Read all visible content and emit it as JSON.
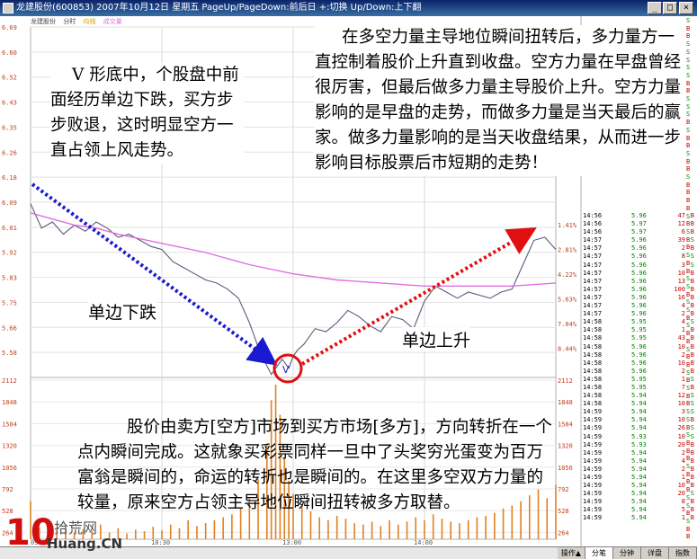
{
  "window": {
    "title": "龙建股份(600853) 2007年10月12日 星期五 PageUp/PageDown:前后日 +:切换 Up/Down:上下翻",
    "minimize_glyph": "_",
    "maximize_glyph": "□",
    "close_glyph": "×"
  },
  "infobar": {
    "stock": "龙建股份",
    "series1": "分时",
    "series2": "均线",
    "series3": "成交量"
  },
  "colors": {
    "price_line": "#5a5a7a",
    "avg_line": "#e070e0",
    "volume": "#e08020",
    "axis_text": "#c04020",
    "up": "#c00000",
    "down": "#008000",
    "arrow_down": "#1a1ad0",
    "arrow_up": "#e01010",
    "circle": "#e01010"
  },
  "chart_data": {
    "type": "line",
    "price_axis": {
      "labels": [
        "6.69",
        "6.60",
        "6.52",
        "6.43",
        "6.35",
        "6.26",
        "6.18",
        "6.09",
        "6.01",
        "5.92",
        "5.83",
        "5.75",
        "5.66",
        "5.58"
      ],
      "ylim": [
        5.54,
        6.69
      ]
    },
    "pct_axis": {
      "labels": [
        "1.41%",
        "2.81%",
        "4.22%",
        "5.63%",
        "7.04%",
        "8.44%"
      ]
    },
    "volume_axis": {
      "labels": [
        "2112",
        "1848",
        "1584",
        "1320",
        "1056",
        "792",
        "528",
        "264"
      ],
      "ylim": [
        0,
        2112
      ]
    },
    "time_labels": [
      "09:30",
      "10:30",
      "13:00",
      "14:00"
    ],
    "series": [
      {
        "name": "分时",
        "x": [
          0,
          5,
          10,
          15,
          20,
          25,
          30,
          35,
          40,
          45,
          50,
          55,
          60,
          65,
          70,
          75,
          80,
          85,
          90,
          95,
          100,
          105,
          110,
          115,
          118,
          120,
          122,
          125,
          130,
          135,
          140,
          145,
          150,
          155,
          160,
          165,
          170,
          175,
          180,
          185,
          190,
          195,
          200,
          205,
          210,
          215,
          220,
          225,
          230,
          235,
          240
        ],
        "values": [
          6.11,
          6.03,
          6.05,
          6.01,
          6.04,
          6.02,
          6.05,
          6.03,
          6.0,
          6.01,
          5.99,
          5.97,
          5.96,
          5.92,
          5.9,
          5.88,
          5.86,
          5.85,
          5.83,
          5.8,
          5.72,
          5.62,
          5.55,
          5.6,
          5.57,
          5.61,
          5.63,
          5.65,
          5.7,
          5.69,
          5.72,
          5.76,
          5.74,
          5.71,
          5.69,
          5.74,
          5.73,
          5.7,
          5.79,
          5.84,
          5.82,
          5.8,
          5.82,
          5.81,
          5.8,
          5.82,
          5.83,
          5.91,
          5.99,
          6.0,
          5.96
        ]
      },
      {
        "name": "均线",
        "x": [
          0,
          10,
          20,
          30,
          40,
          60,
          80,
          100,
          120,
          140,
          160,
          180,
          200,
          220,
          240
        ],
        "values": [
          6.08,
          6.06,
          6.04,
          6.03,
          6.01,
          5.98,
          5.95,
          5.91,
          5.88,
          5.86,
          5.85,
          5.84,
          5.84,
          5.84,
          5.85
        ]
      }
    ],
    "volume": [
      {
        "x": 0,
        "v": 520
      },
      {
        "x": 4,
        "v": 160
      },
      {
        "x": 8,
        "v": 240
      },
      {
        "x": 12,
        "v": 120
      },
      {
        "x": 16,
        "v": 180
      },
      {
        "x": 20,
        "v": 90
      },
      {
        "x": 24,
        "v": 140
      },
      {
        "x": 28,
        "v": 110
      },
      {
        "x": 32,
        "v": 200
      },
      {
        "x": 36,
        "v": 90
      },
      {
        "x": 40,
        "v": 150
      },
      {
        "x": 44,
        "v": 80
      },
      {
        "x": 48,
        "v": 130
      },
      {
        "x": 52,
        "v": 110
      },
      {
        "x": 56,
        "v": 170
      },
      {
        "x": 60,
        "v": 120
      },
      {
        "x": 64,
        "v": 200
      },
      {
        "x": 68,
        "v": 150
      },
      {
        "x": 72,
        "v": 260
      },
      {
        "x": 76,
        "v": 180
      },
      {
        "x": 80,
        "v": 220
      },
      {
        "x": 84,
        "v": 260
      },
      {
        "x": 88,
        "v": 300
      },
      {
        "x": 92,
        "v": 340
      },
      {
        "x": 96,
        "v": 420
      },
      {
        "x": 100,
        "v": 560
      },
      {
        "x": 104,
        "v": 820
      },
      {
        "x": 108,
        "v": 1300
      },
      {
        "x": 110,
        "v": 1900
      },
      {
        "x": 112,
        "v": 2112
      },
      {
        "x": 114,
        "v": 1700
      },
      {
        "x": 116,
        "v": 1100
      },
      {
        "x": 118,
        "v": 800
      },
      {
        "x": 120,
        "v": 620
      },
      {
        "x": 124,
        "v": 480
      },
      {
        "x": 128,
        "v": 380
      },
      {
        "x": 132,
        "v": 300
      },
      {
        "x": 136,
        "v": 260
      },
      {
        "x": 140,
        "v": 320
      },
      {
        "x": 144,
        "v": 280
      },
      {
        "x": 148,
        "v": 220
      },
      {
        "x": 152,
        "v": 200
      },
      {
        "x": 156,
        "v": 240
      },
      {
        "x": 160,
        "v": 180
      },
      {
        "x": 164,
        "v": 260
      },
      {
        "x": 168,
        "v": 200
      },
      {
        "x": 172,
        "v": 240
      },
      {
        "x": 176,
        "v": 300
      },
      {
        "x": 180,
        "v": 260
      },
      {
        "x": 184,
        "v": 340
      },
      {
        "x": 188,
        "v": 280
      },
      {
        "x": 192,
        "v": 240
      },
      {
        "x": 196,
        "v": 220
      },
      {
        "x": 200,
        "v": 260
      },
      {
        "x": 204,
        "v": 300
      },
      {
        "x": 208,
        "v": 320
      },
      {
        "x": 212,
        "v": 360
      },
      {
        "x": 216,
        "v": 420
      },
      {
        "x": 220,
        "v": 460
      },
      {
        "x": 224,
        "v": 520
      },
      {
        "x": 228,
        "v": 600
      },
      {
        "x": 232,
        "v": 680
      },
      {
        "x": 236,
        "v": 560
      },
      {
        "x": 240,
        "v": 740
      }
    ],
    "xlim": [
      0,
      240
    ]
  },
  "annotations": {
    "left_note": "V 形底中，个股盘中前面经历单边下跌，买方步步败退，这时明显空方一直占领上风走势。",
    "right_note": "在多空力量主导地位瞬间扭转后，多力量方一直控制着股价上升直到收盘。空方力量在早盘曾经很厉害，但最后做多力量主导股价上升。空方力量影响的是早盘的走势，而做多力量是当天最后的赢家。做多力量影响的是当天收盘结果，从而进一步影响目标股票后市短期的走势！",
    "bottom_note": "股价由卖方[空方]市场到买方市场[多方]，方向转折在一个点内瞬间完成。这就象买彩票同样一旦中了头奖穷光蛋变为百万富翁是瞬间的，命运的转折也是瞬间的。在这里多空双方力量的较量，原来空方占领主导地位瞬间扭转被多方取替。",
    "down_label": "单边下跌",
    "up_label": "单边上升",
    "v_mark": "V"
  },
  "ticks": [
    {
      "time": "14:56",
      "price": "5.96",
      "vol": "47",
      "dir": "B"
    },
    {
      "time": "14:56",
      "price": "5.97",
      "vol": "12",
      "dir": "B"
    },
    {
      "time": "14:56",
      "price": "5.97",
      "vol": "6",
      "dir": "B"
    },
    {
      "time": "14:57",
      "price": "5.96",
      "vol": "39",
      "dir": "S"
    },
    {
      "time": "14:57",
      "price": "5.96",
      "vol": "2",
      "dir": "B"
    },
    {
      "time": "14:57",
      "price": "5.96",
      "vol": "8",
      "dir": "S"
    },
    {
      "time": "14:57",
      "price": "5.96",
      "vol": "3",
      "dir": "S"
    },
    {
      "time": "14:57",
      "price": "5.96",
      "vol": "10",
      "dir": "B"
    },
    {
      "time": "14:57",
      "price": "5.96",
      "vol": "13",
      "dir": "B"
    },
    {
      "time": "14:57",
      "price": "5.96",
      "vol": "100",
      "dir": "B"
    },
    {
      "time": "14:57",
      "price": "5.96",
      "vol": "16",
      "dir": "B"
    },
    {
      "time": "14:57",
      "price": "5.96",
      "vol": "4",
      "dir": "B"
    },
    {
      "time": "14:57",
      "price": "5.96",
      "vol": "2",
      "dir": "B"
    },
    {
      "time": "14:58",
      "price": "5.95",
      "vol": "4",
      "dir": "S"
    },
    {
      "time": "14:58",
      "price": "5.95",
      "vol": "1",
      "dir": "B"
    },
    {
      "time": "14:58",
      "price": "5.95",
      "vol": "43",
      "dir": "B"
    },
    {
      "time": "14:58",
      "price": "5.96",
      "vol": "10",
      "dir": "B"
    },
    {
      "time": "14:58",
      "price": "5.96",
      "vol": "2",
      "dir": "B"
    },
    {
      "time": "14:58",
      "price": "5.96",
      "vol": "10",
      "dir": "B"
    },
    {
      "time": "14:58",
      "price": "5.96",
      "vol": "2",
      "dir": "B"
    },
    {
      "time": "14:58",
      "price": "5.95",
      "vol": "1",
      "dir": "S"
    },
    {
      "time": "14:58",
      "price": "5.95",
      "vol": "7",
      "dir": "B"
    },
    {
      "time": "14:58",
      "price": "5.94",
      "vol": "12",
      "dir": "S"
    },
    {
      "time": "14:58",
      "price": "5.94",
      "vol": "10",
      "dir": "S"
    },
    {
      "time": "14:59",
      "price": "5.94",
      "vol": "3",
      "dir": "S"
    },
    {
      "time": "14:59",
      "price": "5.94",
      "vol": "10",
      "dir": "B"
    },
    {
      "time": "14:59",
      "price": "5.94",
      "vol": "26",
      "dir": "S"
    },
    {
      "time": "14:59",
      "price": "5.93",
      "vol": "10",
      "dir": "S"
    },
    {
      "time": "14:59",
      "price": "5.93",
      "vol": "20",
      "dir": "B"
    },
    {
      "time": "14:59",
      "price": "5.94",
      "vol": "2",
      "dir": "B"
    },
    {
      "time": "14:59",
      "price": "5.94",
      "vol": "4",
      "dir": "B"
    },
    {
      "time": "14:59",
      "price": "5.94",
      "vol": "2",
      "dir": "B"
    },
    {
      "time": "14:59",
      "price": "5.94",
      "vol": "1",
      "dir": "B"
    },
    {
      "time": "14:59",
      "price": "5.94",
      "vol": "10",
      "dir": "B"
    },
    {
      "time": "14:59",
      "price": "5.94",
      "vol": "20",
      "dir": "S"
    },
    {
      "time": "14:59",
      "price": "5.94",
      "vol": "8",
      "dir": "B"
    },
    {
      "time": "14:59",
      "price": "5.94",
      "vol": "5",
      "dir": "B"
    },
    {
      "time": "14:59",
      "price": "5.94",
      "vol": "1",
      "dir": "B"
    }
  ],
  "side_letters": [
    "S",
    "B",
    "B",
    "S",
    "S",
    "S",
    "S",
    "S",
    "B",
    "B",
    "S",
    "S",
    "S",
    "B",
    "S",
    "B",
    "B",
    "S",
    "B",
    "B",
    "S",
    "B",
    "B",
    "B",
    "B",
    "S",
    "B",
    "S",
    "B",
    "B",
    "S",
    "B",
    "B",
    "S",
    "S",
    "B",
    "S",
    "S",
    "B",
    "S",
    "B",
    "B",
    "S",
    "B",
    "B",
    "S",
    "B",
    "S",
    "B",
    "B",
    "S",
    "S",
    "B",
    "S",
    "B",
    "B",
    "B",
    "S",
    "B",
    "B",
    "B",
    "S",
    "S",
    "B",
    "S",
    "B",
    "B"
  ],
  "tabs": [
    {
      "label": "操作▲",
      "active": false
    },
    {
      "label": "分笔",
      "active": true
    },
    {
      "label": "分钟",
      "active": false
    },
    {
      "label": "详盘",
      "active": false
    },
    {
      "label": "指数",
      "active": false
    }
  ],
  "logo": {
    "cn": "拾荒网",
    "en": "Huang.CN",
    "digit": "10"
  }
}
